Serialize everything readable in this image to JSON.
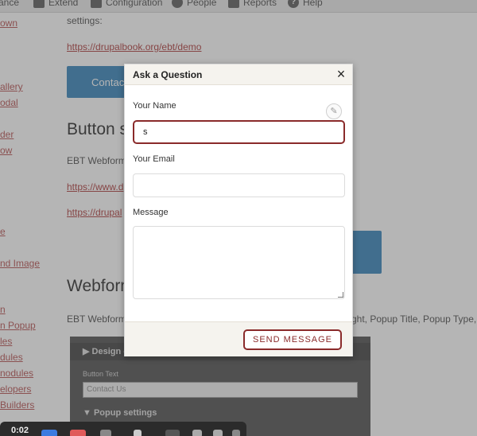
{
  "toolbar": {
    "items": [
      {
        "label": "ance"
      },
      {
        "label": "Extend"
      },
      {
        "label": "Configuration"
      },
      {
        "label": "People"
      },
      {
        "label": "Reports"
      },
      {
        "label": "Help",
        "icon_glyph": "?"
      }
    ]
  },
  "sidebar": {
    "links": [
      "own",
      "allery",
      "odal",
      "der",
      "ow",
      "e",
      "nd Image",
      "n",
      "n Popup",
      "les",
      "dules",
      "nodules",
      "elopers",
      "Builders"
    ]
  },
  "main": {
    "settings_text": "settings:",
    "demo_link": "https://drupalbook.org/ebt/demo",
    "contact_button": "Contac",
    "heading_button": "Button s",
    "ebt_webform_text": "EBT Webform",
    "link_www": "https://www.d",
    "link_drupal": "https://drupal",
    "heading_webform": "Webform",
    "ebt_webform_text2": "EBT Webform",
    "tail_text": "ght, Popup Title, Popup Type,"
  },
  "dark_panel": {
    "design_label": "▶ Design o",
    "button_text_label": "Button Text",
    "button_text_value": "Contact Us",
    "popup_settings": "▼ Popup settings"
  },
  "taskbar": {
    "clock": "0:02"
  },
  "modal": {
    "title": "Ask a Question",
    "close_glyph": "×",
    "name_label": "Your Name",
    "name_value": "s",
    "email_label": "Your Email",
    "email_value": "",
    "message_label": "Message",
    "send_label": "SEND MESSAGE",
    "pencil_glyph": "✎"
  }
}
